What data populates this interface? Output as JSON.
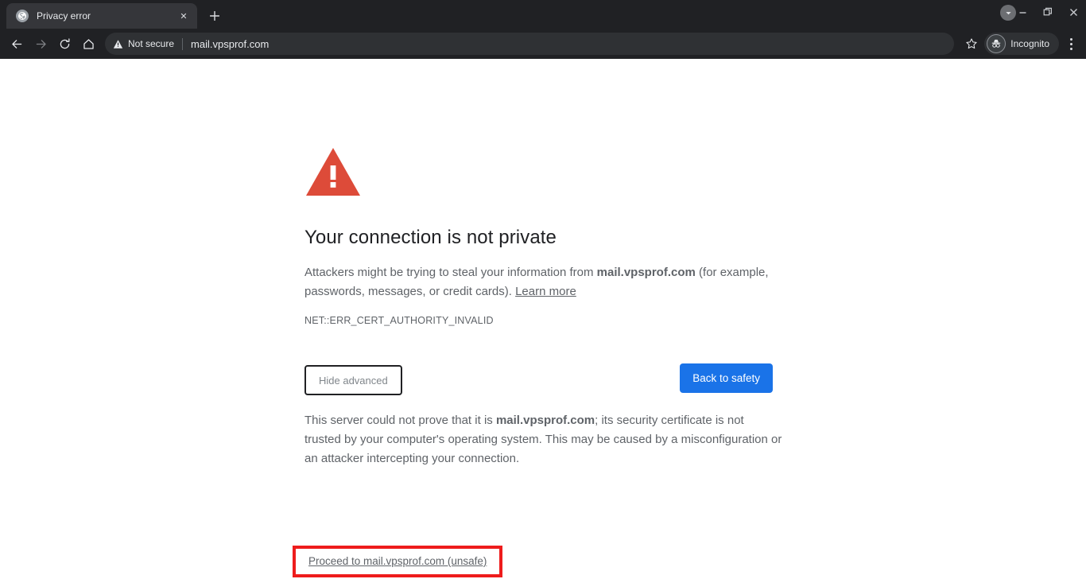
{
  "window": {
    "controls": [
      {
        "name": "minimize",
        "glyph": "—"
      },
      {
        "name": "restore",
        "glyph": "❐"
      },
      {
        "name": "close",
        "glyph": "✕"
      }
    ]
  },
  "tabstrip": {
    "tab": {
      "title": "Privacy error",
      "favicon": "globe-icon",
      "close_glyph": "✕"
    },
    "new_tab_glyph": "+",
    "tab_search": "chevron-down-icon"
  },
  "toolbar": {
    "back": "back-arrow-icon",
    "forward": "forward-arrow-icon",
    "reload": "reload-icon",
    "home": "home-icon",
    "security_label": "Not secure",
    "security_icon": "warning-triangle-icon",
    "url": "mail.vpsprof.com",
    "bookmark": "star-icon",
    "profile_label": "Incognito",
    "profile_icon": "incognito-icon",
    "menu": "kebab-menu-icon"
  },
  "page": {
    "icon": "warning-triangle-icon",
    "title": "Your connection is not private",
    "paragraph": {
      "before": "Attackers might be trying to steal your information from ",
      "domain": "mail.vpsprof.com",
      "after": " (for example, passwords, messages, or credit cards). ",
      "link": "Learn more"
    },
    "error_code": "NET::ERR_CERT_AUTHORITY_INVALID",
    "buttons": {
      "advanced": "Hide advanced",
      "safety": "Back to safety"
    },
    "advanced": {
      "before": "This server could not prove that it is ",
      "domain": "mail.vpsprof.com",
      "after": "; its security certificate is not trusted by your computer's operating system. This may be caused by a misconfiguration or an attacker intercepting your connection."
    },
    "proceed_link": "Proceed to mail.vpsprof.com (unsafe)",
    "annotation_color": "#ee1c1c"
  },
  "colors": {
    "chrome_bg": "#202124",
    "accent_blue": "#1a73e8",
    "warning_red": "#dd4b39",
    "annotation_red": "#ee1c1c"
  }
}
